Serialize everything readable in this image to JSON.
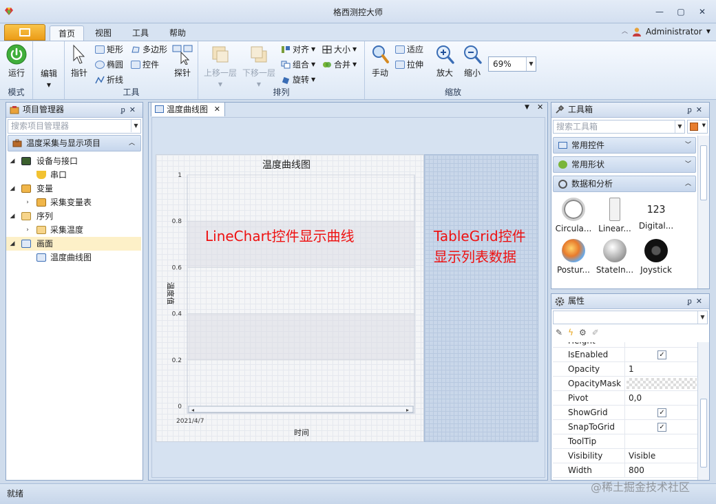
{
  "window": {
    "title": "格西测控大师"
  },
  "menu_tabs": [
    "首页",
    "视图",
    "工具",
    "帮助"
  ],
  "user": {
    "name": "Administrator"
  },
  "ribbon": {
    "mode": {
      "run": "运行",
      "edit": "编辑",
      "label": "模式"
    },
    "tools": {
      "pointer": "指针",
      "rect": "矩形",
      "ellipse": "椭圆",
      "polyline": "折线",
      "polygon": "多边形",
      "control": "控件",
      "probe": "探针",
      "label": "工具"
    },
    "arrange": {
      "up": "上移一层",
      "down": "下移一层",
      "align": "对齐",
      "group": "组合",
      "rotate": "旋转",
      "size": "大小",
      "merge": "合并",
      "label": "排列"
    },
    "zoom": {
      "hand": "手动",
      "fit": "适应",
      "stretch": "拉伸",
      "zoom_in": "放大",
      "zoom_out": "缩小",
      "value": "69%",
      "label": "缩放"
    }
  },
  "project": {
    "title": "项目管理器",
    "search_placeholder": "搜索项目管理器",
    "group": "温度采集与显示项目",
    "tree": [
      {
        "label": "设备与接口",
        "level": 0,
        "expanded": true
      },
      {
        "label": "串口",
        "level": 1
      },
      {
        "label": "变量",
        "level": 0,
        "expanded": true
      },
      {
        "label": "采集变量表",
        "level": 1,
        "collapsed": true
      },
      {
        "label": "序列",
        "level": 0,
        "expanded": true
      },
      {
        "label": "采集温度",
        "level": 1,
        "collapsed": true
      },
      {
        "label": "画面",
        "level": 0,
        "expanded": true,
        "selected": true
      },
      {
        "label": "温度曲线图",
        "level": 1
      }
    ]
  },
  "document": {
    "tab": "温度曲线图",
    "chart_title": "温度曲线图",
    "annotation_left": "LineChart控件显示曲线",
    "annotation_right_1": "TableGrid控件",
    "annotation_right_2": "显示列表数据"
  },
  "chart_data": {
    "type": "line",
    "title": "温度曲线图",
    "xlabel": "时间",
    "ylabel": "温度值",
    "x": [
      "2021/4/7"
    ],
    "y_ticks": [
      "1",
      "0.8",
      "0.6",
      "0.4",
      "0.2",
      "0"
    ],
    "ylim": [
      0,
      1
    ],
    "series": []
  },
  "toolbox": {
    "title": "工具箱",
    "search_placeholder": "搜索工具箱",
    "groups": [
      "常用控件",
      "常用形状",
      "数据和分析"
    ],
    "items": [
      "Circula...",
      "Linear...",
      "Digital...",
      "Postur...",
      "StateIn...",
      "Joystick"
    ],
    "digital_text": "123"
  },
  "properties": {
    "title": "属性",
    "partial_row": "Height",
    "rows": [
      {
        "name": "IsEnabled",
        "value": "",
        "check": true
      },
      {
        "name": "Opacity",
        "value": "1"
      },
      {
        "name": "OpacityMask",
        "value": "",
        "pattern": true
      },
      {
        "name": "Pivot",
        "value": "0,0"
      },
      {
        "name": "ShowGrid",
        "value": "",
        "check": true
      },
      {
        "name": "SnapToGrid",
        "value": "",
        "check": true
      },
      {
        "name": "ToolTip",
        "value": ""
      },
      {
        "name": "Visibility",
        "value": "Visible"
      },
      {
        "name": "Width",
        "value": "800"
      }
    ]
  },
  "status": {
    "text": "就绪",
    "watermark": "@稀土掘金技术社区"
  },
  "colors": {
    "accent": "#eb9b17",
    "annotation": "#ee1111",
    "ribbon": "#dde8f5",
    "panel_border": "#8ea7c9"
  }
}
